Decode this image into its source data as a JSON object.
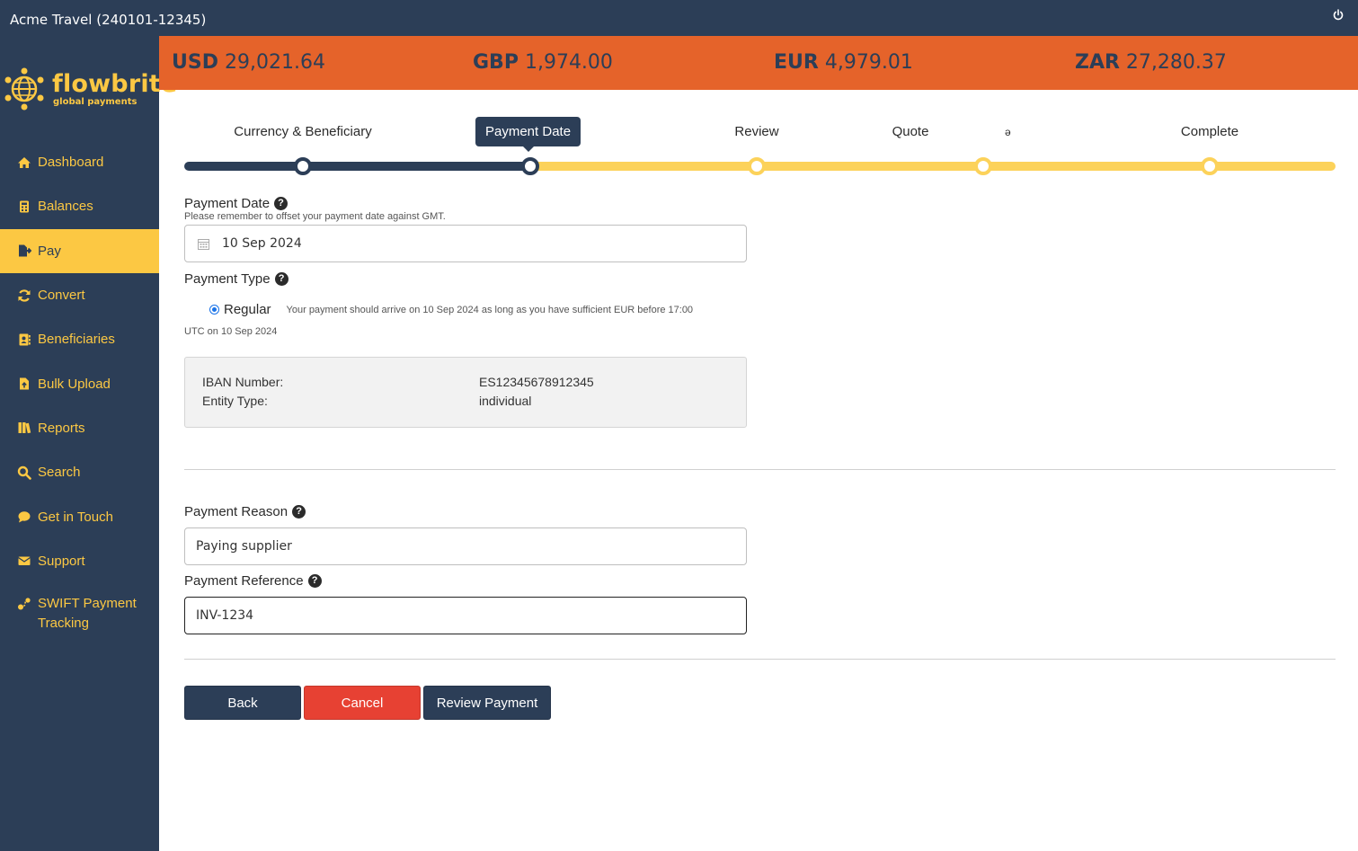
{
  "window": {
    "title": "Acme Travel (240101-12345)"
  },
  "brand": {
    "name": "flowbrite",
    "tagline": "global payments",
    "accent": "#fcc843",
    "navy": "#2c3e57",
    "orange": "#e5632a"
  },
  "balances": [
    {
      "currency": "USD",
      "amount": "29,021.64"
    },
    {
      "currency": "GBP",
      "amount": "1,974.00"
    },
    {
      "currency": "EUR",
      "amount": "4,979.01"
    },
    {
      "currency": "ZAR",
      "amount": "27,280.37"
    }
  ],
  "nav": {
    "items": [
      {
        "label": "Dashboard",
        "icon": "home-icon"
      },
      {
        "label": "Balances",
        "icon": "calculator-icon"
      },
      {
        "label": "Pay",
        "icon": "file-export-icon",
        "active": true
      },
      {
        "label": "Convert",
        "icon": "sync-icon"
      },
      {
        "label": "Beneficiaries",
        "icon": "address-book-icon"
      },
      {
        "label": "Bulk Upload",
        "icon": "file-upload-icon"
      },
      {
        "label": "Reports",
        "icon": "books-icon"
      },
      {
        "label": "Search",
        "icon": "search-icon"
      },
      {
        "label": "Get in Touch",
        "icon": "chat-icon"
      },
      {
        "label": "Support",
        "icon": "envelope-icon"
      },
      {
        "label": "SWIFT Payment Tracking",
        "icon": "tracking-icon"
      }
    ]
  },
  "stepper": {
    "steps": [
      {
        "label": "Currency & Beneficiary",
        "status": "done"
      },
      {
        "label": "Payment Date",
        "status": "current"
      },
      {
        "label": "Review",
        "status": "todo"
      },
      {
        "label": "Quote",
        "status": "todo"
      },
      {
        "label": "Complete",
        "status": "todo"
      }
    ],
    "stray_glyph": "ə"
  },
  "form": {
    "payment_date": {
      "label": "Payment Date",
      "hint": "Please remember to offset your payment date against GMT.",
      "value": "10 Sep 2024"
    },
    "payment_type": {
      "label": "Payment Type",
      "option": "Regular",
      "selected": true,
      "note_line1": "Your payment should arrive on 10 Sep 2024 as long as you have sufficient EUR before 17:00",
      "note_line2": "UTC on 10 Sep 2024"
    },
    "beneficiary_info": {
      "iban_label": "IBAN Number:",
      "iban_value": "ES12345678912345",
      "entity_label": "Entity Type:",
      "entity_value": "individual"
    },
    "payment_reason": {
      "label": "Payment Reason",
      "value": "Paying supplier"
    },
    "payment_reference": {
      "label": "Payment Reference",
      "value": "INV-1234"
    }
  },
  "actions": {
    "back": "Back",
    "cancel": "Cancel",
    "review": "Review Payment"
  }
}
